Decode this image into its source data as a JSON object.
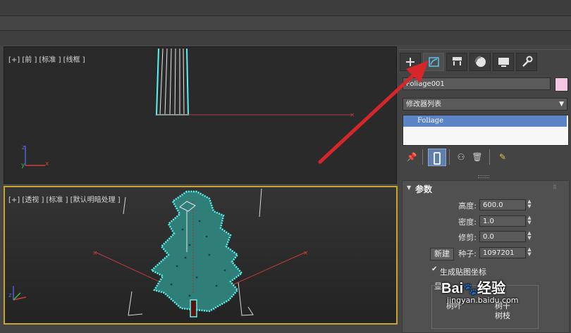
{
  "viewports": {
    "front": {
      "label": "[+] [前 ] [标准 ] [线框 ]"
    },
    "perspective": {
      "label": "[+] [透视 ] [标准 ] [默认明暗处理 ]"
    }
  },
  "command_panel": {
    "tabs": [
      {
        "icon": "create-plus-icon"
      },
      {
        "icon": "modify-icon"
      },
      {
        "icon": "hierarchy-icon"
      },
      {
        "icon": "motion-icon"
      },
      {
        "icon": "display-icon"
      },
      {
        "icon": "utilities-wrench-icon"
      }
    ],
    "object_name": "Foliage001",
    "object_color": "#f4c6e6",
    "modifier_list_label": "修改器列表",
    "modifier_stack": [
      "Foliage"
    ],
    "params": {
      "title": "参数",
      "height_label": "高度:",
      "height_value": "600.0",
      "density_label": "密度:",
      "density_value": "1.0",
      "prune_label": "修剪:",
      "prune_value": "0.0",
      "new_button": "新建",
      "seed_label": "种子:",
      "seed_value": "1097201",
      "gen_mapping_label": "生成贴图坐标",
      "display_label": "显示",
      "opt1": "树叶",
      "opt2": "树干",
      "opt3": "树枝"
    }
  },
  "watermark": {
    "brand_prefix": "Bai",
    "brand_suffix": "经验",
    "url": "jingyan.baidu.com"
  },
  "annotation_color": "#d6262a",
  "accent_cyan": "#59f2f0"
}
